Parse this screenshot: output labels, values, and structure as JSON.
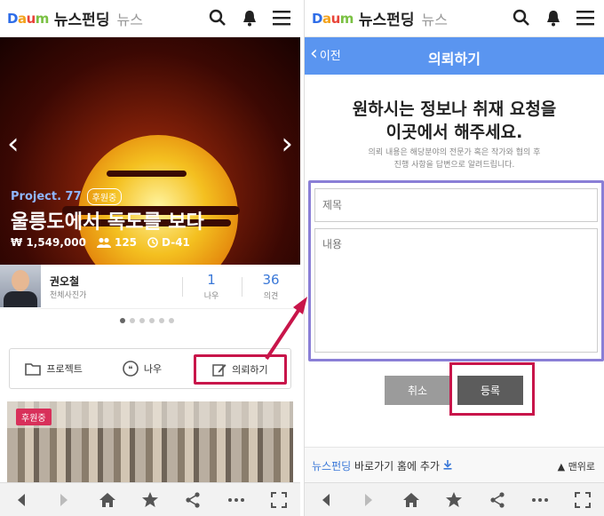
{
  "logo_text": "Daum",
  "colors": {
    "accent_blue": "#5a95f0",
    "highlight_red": "#c8154a",
    "form_border": "#8a7fd6"
  },
  "left": {
    "brand": "뉴스펀딩",
    "section": "뉴스",
    "hero": {
      "project_label": "Project. 77",
      "status_badge": "후원중",
      "title": "울릉도에서 독도를 보다",
      "amount": "₩ 1,549,000",
      "backers": "125",
      "days_left": "D-41"
    },
    "profile": {
      "name": "권오철",
      "role": "천체사진가",
      "stat1_value": "1",
      "stat1_label": "나우",
      "stat2_value": "36",
      "stat2_label": "의견"
    },
    "pager_total": 6,
    "actions": {
      "project": "프로젝트",
      "now": "나우",
      "request": "의뢰하기"
    },
    "card_badge": "후원중"
  },
  "right": {
    "brand": "뉴스펀딩",
    "section": "뉴스",
    "back_label": "이전",
    "header_title": "의뢰하기",
    "request_title_line1": "원하시는 정보나 취재 요청을",
    "request_title_line2": "이곳에서 해주세요.",
    "request_desc_line1": "의뢰 내용은 해당분야의 전문가 혹은 작가와 협의 후",
    "request_desc_line2": "진행 사항을 답변으로 알려드립니다.",
    "title_placeholder": "제목",
    "content_placeholder": "내용",
    "cancel_label": "취소",
    "submit_label": "등록",
    "shortcut_brand": "뉴스펀딩",
    "shortcut_text": " 바로가기 홈에 추가",
    "to_top_label": "맨위로"
  }
}
